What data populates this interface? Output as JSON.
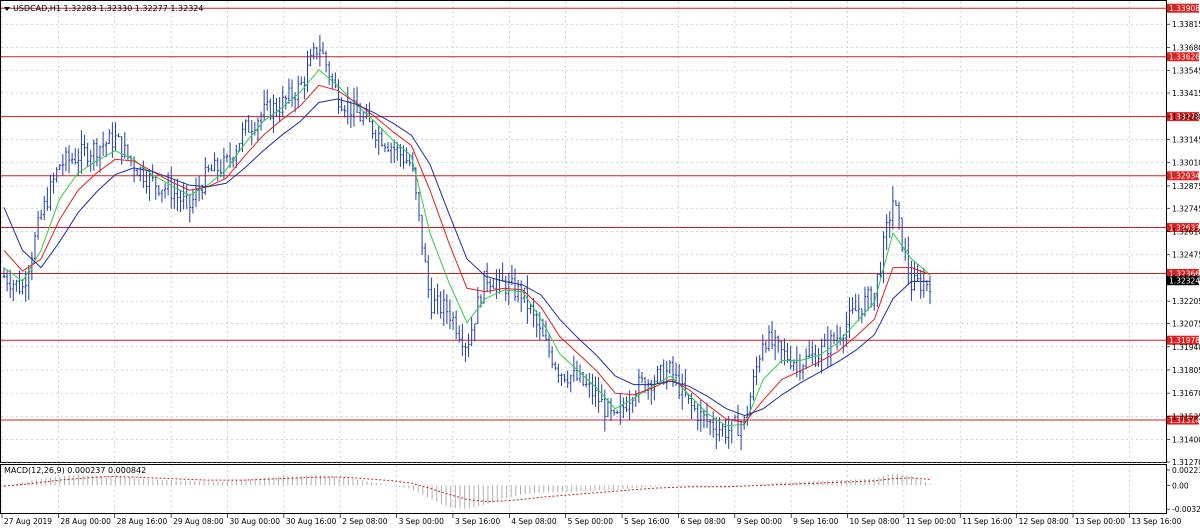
{
  "window": {
    "title": "USDCAD,H1  1.32283 1.32330 1.32277 1.32324",
    "macd_title": "MACD(12,26,9) 0.000237 0.000842"
  },
  "colors": {
    "background": "#ffffff",
    "grid": "#c0c0c0",
    "candle": "#1f3fa8",
    "ma_fast": "#2ecc40",
    "ma_mid": "#e02020",
    "ma_slow": "#1f2f9f",
    "level_line": "#cc2020",
    "level_tag": "#e02020",
    "price_tag": "#000000",
    "macd_hist": "#b0b0b0",
    "macd_signal": "#cc2020"
  },
  "chart_data": [
    {
      "type": "line",
      "title": "USDCAD,H1",
      "price_axis": {
        "ylim": [
          1.3127,
          1.3395
        ],
        "ticks": [
          "1.33815",
          "1.33680",
          "1.33545",
          "1.33415",
          "1.33280",
          "1.33145",
          "1.33010",
          "1.32875",
          "1.32745",
          "1.32610",
          "1.32475",
          "1.32340",
          "1.32205",
          "1.32075",
          "1.31940",
          "1.31805",
          "1.31670",
          "1.31535",
          "1.31400",
          "1.31270"
        ]
      },
      "levels": [
        "1.33908",
        "1.33626",
        "1.33278",
        "1.32934",
        "1.32633",
        "1.32366",
        "1.31978",
        "1.31514"
      ],
      "current_price": "1.32324",
      "x_labels": [
        "27 Aug 2019",
        "28 Aug 00:00",
        "28 Aug 16:00",
        "29 Aug 08:00",
        "30 Aug 00:00",
        "30 Aug 16:00",
        "2 Sep 08:00",
        "3 Sep 00:00",
        "3 Sep 16:00",
        "4 Sep 08:00",
        "5 Sep 00:00",
        "5 Sep 16:00",
        "6 Sep 08:00",
        "9 Sep 00:00",
        "9 Sep 16:00",
        "10 Sep 08:00",
        "11 Sep 00:00",
        "11 Sep 16:00",
        "12 Sep 08:00",
        "13 Sep 00:00",
        "13 Sep 16:00"
      ],
      "close_keypoints": [
        1.3235,
        1.3228,
        1.327,
        1.33,
        1.3305,
        1.331,
        1.3315,
        1.33,
        1.329,
        1.3285,
        1.3275,
        1.3295,
        1.33,
        1.332,
        1.333,
        1.3335,
        1.3345,
        1.337,
        1.334,
        1.333,
        1.332,
        1.331,
        1.33,
        1.322,
        1.3215,
        1.3195,
        1.3235,
        1.323,
        1.3225,
        1.32,
        1.318,
        1.3175,
        1.3165,
        1.315,
        1.317,
        1.3175,
        1.318,
        1.316,
        1.315,
        1.3145,
        1.315,
        1.32,
        1.319,
        1.3185,
        1.319,
        1.32,
        1.3215,
        1.3225,
        1.328,
        1.323,
        1.3232
      ],
      "series": [
        {
          "name": "MA fast",
          "values": [
            1.324,
            1.3232,
            1.325,
            1.328,
            1.3295,
            1.3302,
            1.3308,
            1.3303,
            1.3294,
            1.3288,
            1.3282,
            1.3288,
            1.3297,
            1.3312,
            1.3325,
            1.3333,
            1.3342,
            1.3355,
            1.3346,
            1.3335,
            1.3325,
            1.3314,
            1.3305,
            1.326,
            1.3232,
            1.3208,
            1.3222,
            1.3227,
            1.3226,
            1.321,
            1.319,
            1.318,
            1.317,
            1.3158,
            1.3164,
            1.3171,
            1.3177,
            1.3166,
            1.3155,
            1.3148,
            1.3149,
            1.3175,
            1.3186,
            1.3186,
            1.3189,
            1.3196,
            1.3208,
            1.322,
            1.326,
            1.3245,
            1.3236
          ]
        },
        {
          "name": "MA mid",
          "values": [
            1.325,
            1.3238,
            1.3245,
            1.3268,
            1.3285,
            1.3295,
            1.3303,
            1.3302,
            1.3296,
            1.329,
            1.3285,
            1.3287,
            1.3292,
            1.3305,
            1.3317,
            1.3326,
            1.3334,
            1.3346,
            1.3343,
            1.3336,
            1.3328,
            1.3319,
            1.3311,
            1.3285,
            1.3255,
            1.3228,
            1.3226,
            1.3228,
            1.3227,
            1.3217,
            1.32,
            1.319,
            1.318,
            1.3167,
            1.3166,
            1.317,
            1.3175,
            1.3169,
            1.316,
            1.3152,
            1.315,
            1.3163,
            1.3175,
            1.318,
            1.3185,
            1.3191,
            1.32,
            1.321,
            1.324,
            1.324,
            1.3236
          ]
        },
        {
          "name": "MA slow",
          "values": [
            1.3275,
            1.325,
            1.324,
            1.3255,
            1.3272,
            1.3284,
            1.3294,
            1.3298,
            1.3296,
            1.3292,
            1.3288,
            1.3287,
            1.3289,
            1.3298,
            1.3308,
            1.3317,
            1.3325,
            1.3336,
            1.3338,
            1.3335,
            1.333,
            1.3324,
            1.3317,
            1.33,
            1.3272,
            1.3245,
            1.3235,
            1.3232,
            1.323,
            1.3224,
            1.321,
            1.3199,
            1.3189,
            1.3177,
            1.3172,
            1.3172,
            1.3174,
            1.3171,
            1.3165,
            1.3158,
            1.3154,
            1.3158,
            1.3166,
            1.3173,
            1.3179,
            1.3185,
            1.3192,
            1.3201,
            1.3222,
            1.3232,
            1.3232
          ]
        }
      ]
    },
    {
      "type": "bar",
      "title": "MACD(12,26,9)",
      "ticks": [
        "0.002238",
        "0.00",
        "-0.003222"
      ],
      "ylim": [
        -0.0036,
        0.0026
      ],
      "histogram": [
        -0.0002,
        0.0004,
        0.0009,
        0.0012,
        0.0014,
        0.0013,
        0.0012,
        0.001,
        0.0008,
        0.0007,
        0.0006,
        0.0005,
        0.0006,
        0.0008,
        0.001,
        0.0012,
        0.0013,
        0.0014,
        0.0011,
        0.0008,
        0.0004,
        0.0,
        -0.0005,
        -0.0018,
        -0.003,
        -0.0032,
        -0.0026,
        -0.0018,
        -0.0012,
        -0.001,
        -0.0009,
        -0.0008,
        -0.0007,
        -0.0006,
        -0.0004,
        -0.0002,
        0.0,
        -0.0001,
        -0.0002,
        -0.0002,
        -0.0001,
        0.0002,
        0.0004,
        0.0005,
        0.0006,
        0.0007,
        0.0008,
        0.0009,
        0.0016,
        0.0012,
        0.0002
      ],
      "signal": [
        -0.0001,
        0.0001,
        0.0004,
        0.0007,
        0.0009,
        0.0011,
        0.0012,
        0.0011,
        0.001,
        0.0009,
        0.0008,
        0.0007,
        0.0007,
        0.0007,
        0.0008,
        0.0009,
        0.001,
        0.0011,
        0.0011,
        0.001,
        0.0008,
        0.0006,
        0.0003,
        -0.0004,
        -0.0012,
        -0.0019,
        -0.0022,
        -0.0021,
        -0.0019,
        -0.0016,
        -0.0014,
        -0.0012,
        -0.001,
        -0.0008,
        -0.0006,
        -0.0004,
        -0.0003,
        -0.0002,
        -0.0002,
        -0.0002,
        -0.0001,
        0.0,
        0.0001,
        0.0002,
        0.0003,
        0.0004,
        0.0005,
        0.0006,
        0.0009,
        0.001,
        0.0008
      ]
    }
  ]
}
